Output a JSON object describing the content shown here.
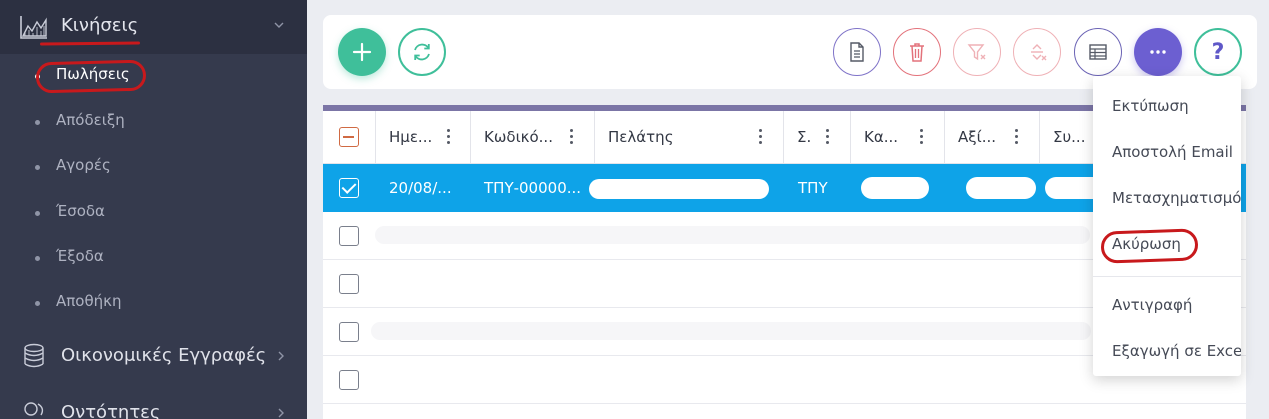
{
  "sidebar": {
    "header": {
      "label": "Κινήσεις",
      "icon": "area-chart-icon"
    },
    "items": [
      {
        "label": "Πωλήσεις",
        "active": true
      },
      {
        "label": "Απόδειξη",
        "active": false
      },
      {
        "label": "Αγορές",
        "active": false
      },
      {
        "label": "Έσοδα",
        "active": false
      },
      {
        "label": "Έξοδα",
        "active": false
      },
      {
        "label": "Αποθήκη",
        "active": false
      }
    ],
    "groups": [
      {
        "label": "Οικονομικές Εγγραφές",
        "icon": "coins-icon"
      },
      {
        "label": "Οντότητες",
        "icon": "users-icon"
      }
    ]
  },
  "toolbar": {
    "help_label": "?",
    "colors": {
      "green": "#3fbf9a",
      "purple": "#6c5fd1",
      "red": "#e3727b"
    }
  },
  "grid": {
    "columns": [
      {
        "label": "Ημε..."
      },
      {
        "label": "Κωδικό..."
      },
      {
        "label": "Πελάτης"
      },
      {
        "label": "Σ."
      },
      {
        "label": "Κα..."
      },
      {
        "label": "Αξί..."
      },
      {
        "label": "Συ..."
      }
    ],
    "selected_row": {
      "date": "20/08/...",
      "code": "ΤΠΥ-00000...",
      "series": "ΤΠΥ"
    },
    "selected_color": "#0ea3e8"
  },
  "menu": {
    "items": [
      {
        "label": "Εκτύπωση"
      },
      {
        "label": "Αποστολή Email"
      },
      {
        "label": "Μετασχηματισμός"
      },
      {
        "label": "Ακύρωση"
      },
      {
        "label": "Αντιγραφή"
      },
      {
        "label": "Εξαγωγή σε Excel"
      }
    ]
  }
}
